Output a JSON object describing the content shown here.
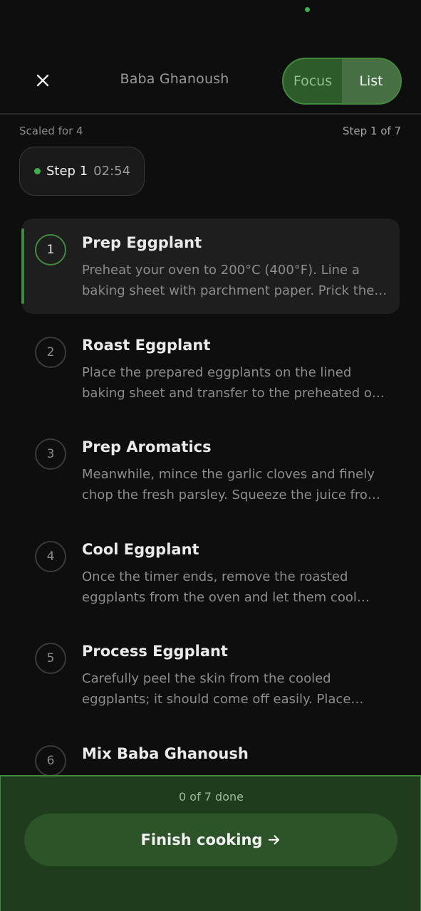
{
  "header": {
    "title": "Baba Ghanoush",
    "toggle": {
      "focus_label": "Focus",
      "list_label": "List",
      "selected": "List"
    }
  },
  "meta": {
    "scaled": "Scaled for 4",
    "step_count": "Step 1 of 7"
  },
  "timer": {
    "step_label": "Step 1",
    "time": "02:54"
  },
  "steps": [
    {
      "number": "1",
      "title": "Prep Eggplant",
      "description": "Preheat your oven to 200°C (400°F). Line a baking sheet with parchment paper. Prick the…"
    },
    {
      "number": "2",
      "title": "Roast Eggplant",
      "description": "Place the prepared eggplants on the lined baking sheet and transfer to the preheated o…"
    },
    {
      "number": "3",
      "title": "Prep Aromatics",
      "description": "Meanwhile, mince the garlic cloves and finely chop the fresh parsley. Squeeze the juice fro…"
    },
    {
      "number": "4",
      "title": "Cool Eggplant",
      "description": "Once the timer ends, remove the roasted eggplants from the oven and let them cool on…"
    },
    {
      "number": "5",
      "title": "Process Eggplant",
      "description": "Carefully peel the skin from the cooled eggplants; it should come off easily. Place the…"
    },
    {
      "number": "6",
      "title": "Mix Baba Ghanoush",
      "description": ""
    }
  ],
  "footer": {
    "done_text": "0 of 7 done",
    "finish_label": "Finish cooking"
  },
  "colors": {
    "accent": "#3f8a3c",
    "background": "#0e0e0e",
    "footer_bg": "#1f3d1d"
  }
}
